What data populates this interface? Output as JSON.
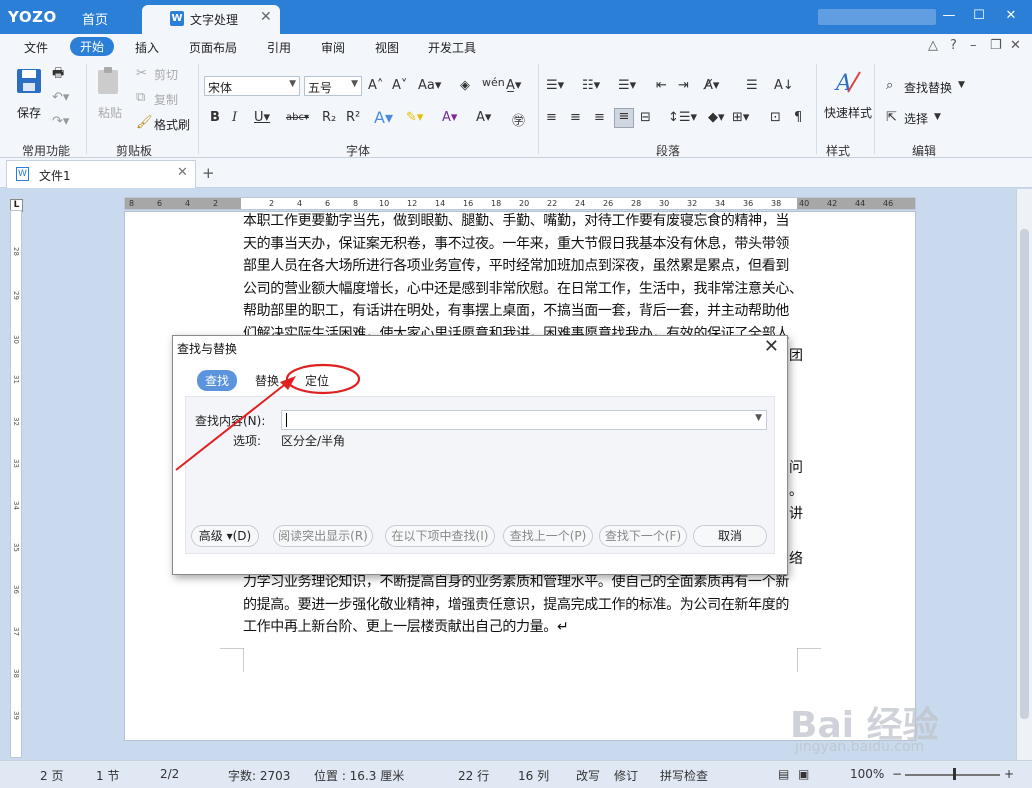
{
  "titlebar": {
    "logo": "YOZO",
    "home": "首页",
    "doc_tab": "文字处理",
    "doc_tab_icon": "W"
  },
  "menu": {
    "items": [
      "文件",
      "开始",
      "插入",
      "页面布局",
      "引用",
      "审阅",
      "视图",
      "开发工具"
    ],
    "active": "开始"
  },
  "ribbon": {
    "save": "保存",
    "paste": "粘贴",
    "cut": "剪切",
    "copy": "复制",
    "format_brush": "格式刷",
    "font_name": "宋体",
    "font_size": "五号",
    "quick_style": "快速样式",
    "find_replace": "查找替换",
    "select": "选择",
    "groups": {
      "common": "常用功能",
      "clipboard": "剪贴板",
      "font": "字体",
      "paragraph": "段落",
      "style": "样式",
      "edit": "编辑"
    }
  },
  "tabs": {
    "file_tab": "文件1",
    "file_icon": "W"
  },
  "ruler": {
    "h_ticks": [
      "8",
      "6",
      "4",
      "2",
      "",
      "2",
      "4",
      "6",
      "8",
      "10",
      "12",
      "14",
      "16",
      "18",
      "20",
      "22",
      "24",
      "26",
      "28",
      "30",
      "32",
      "34",
      "36",
      "38",
      "40",
      "42",
      "44",
      "46",
      "48"
    ],
    "v_ticks": [
      "28",
      "29",
      "30",
      "31",
      "32",
      "33",
      "34",
      "35",
      "36",
      "37",
      "38",
      "39",
      "40",
      "41",
      "42",
      "43",
      "44",
      "45",
      "46",
      "47",
      "48"
    ]
  },
  "document": {
    "lines_top": [
      "本职工作更要勤字当先，做到眼勤、腿勤、手勤、嘴勤，对待工作要有废寝忘食的精神，当",
      "天的事当天办，保证案无积卷，事不过夜。一年来，重大节假日我基本没有休息，带头带领",
      "部里人员在各大场所进行各项业务宣传，平时经常加班加点到深夜，虽然累是累点，但看到",
      "公司的营业额大幅度增长，心中还是感到非常欣慰。在日常工作，生活中，我非常注意关心、",
      "帮助部里的职工，有话讲在明处，有事摆上桌面，不搞当面一套，背后一套，并主动帮助他",
      "们解决实际生活困难，使大家心里话愿意和我讲，困难事愿意找我办，有效的保证了全部人"
    ],
    "lines_bottom": [
      "力学习业务理论知识，不断提高自身的业务素质和管理水平。使自己的全面素质再有一个新",
      "的提高。要进一步强化敬业精神，增强责任意识，提高完成工作的标准。为公司在新年度的",
      "工作中再上新台阶、更上一层楼贡献出自己的力量。↵"
    ],
    "edge_chars": [
      "团",
      "问",
      "。",
      "讲",
      "络"
    ]
  },
  "dialog": {
    "title": "查找与替换",
    "tabs": [
      "查找",
      "替换",
      "定位"
    ],
    "active_tab": "查找",
    "find_label": "查找内容(N):",
    "find_value": "",
    "options_label": "选项:",
    "options_value": "区分全/半角",
    "buttons": [
      "高级 ▾(D)",
      "阅读突出显示(R)",
      "在以下项中查找(I)",
      "查找上一个(P)",
      "查找下一个(F)",
      "取消"
    ],
    "highlight_color": "#e02020"
  },
  "status": {
    "page": "2 页",
    "section": "1 节",
    "page_of": "2/2",
    "word_count": "字数: 2703",
    "position": "位置 : 16.3 厘米",
    "row": "22 行",
    "col": "16 列",
    "overwrite": "改写",
    "revision": "修订",
    "spellcheck": "拼写检查",
    "zoom": "100%"
  },
  "watermark": {
    "brand": "Bai 经验",
    "url": "jingyan.baidu.com"
  }
}
